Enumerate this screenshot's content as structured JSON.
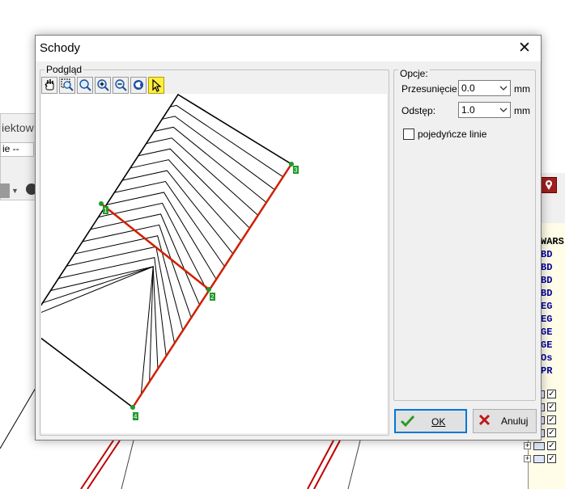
{
  "background": {
    "left_panel": {
      "title": "iektow",
      "combo_value": "ie --"
    },
    "tree_items": [
      {
        "label": "WARS",
        "dark": true
      },
      {
        "label": "BD"
      },
      {
        "label": "BD"
      },
      {
        "label": "BD"
      },
      {
        "label": "BD"
      },
      {
        "label": "EG"
      },
      {
        "label": "EG"
      },
      {
        "label": "GE"
      },
      {
        "label": "GE"
      },
      {
        "label": "Os"
      },
      {
        "label": "PR"
      }
    ]
  },
  "dialog": {
    "title": "Schody",
    "close_symbol": "✕",
    "preview_group_label": "Podgląd",
    "toolbar": [
      {
        "icon": "hand-icon",
        "glyph": "✋"
      },
      {
        "icon": "zoom-window-icon",
        "glyph": "⊡"
      },
      {
        "icon": "zoom-icon",
        "glyph": "🔍"
      },
      {
        "icon": "zoom-in-icon",
        "glyph": "⊕"
      },
      {
        "icon": "zoom-out-icon",
        "glyph": "⊖"
      },
      {
        "icon": "zoom-extents-icon",
        "glyph": "◐"
      },
      {
        "icon": "select-pointer-icon",
        "glyph": "↖",
        "active": true
      }
    ],
    "options": {
      "group_label": "Opcje:",
      "offset_label": "Przesunięcie:",
      "offset_value": "0.0",
      "spacing_label": "Odstęp:",
      "spacing_value": "1.0",
      "unit": "mm",
      "single_lines_label": "pojedyńcze linie",
      "single_lines_checked": false
    },
    "buttons": {
      "ok": "OK",
      "cancel": "Anuluj"
    },
    "preview_markers": {
      "point_1": "1",
      "point_2": "2",
      "point_3": "3",
      "point_4": "4"
    },
    "colors": {
      "accent": "#0078d7",
      "walking_line": "#d02000",
      "marker": "#1e9a2a",
      "active_tool": "#ffef40"
    }
  }
}
